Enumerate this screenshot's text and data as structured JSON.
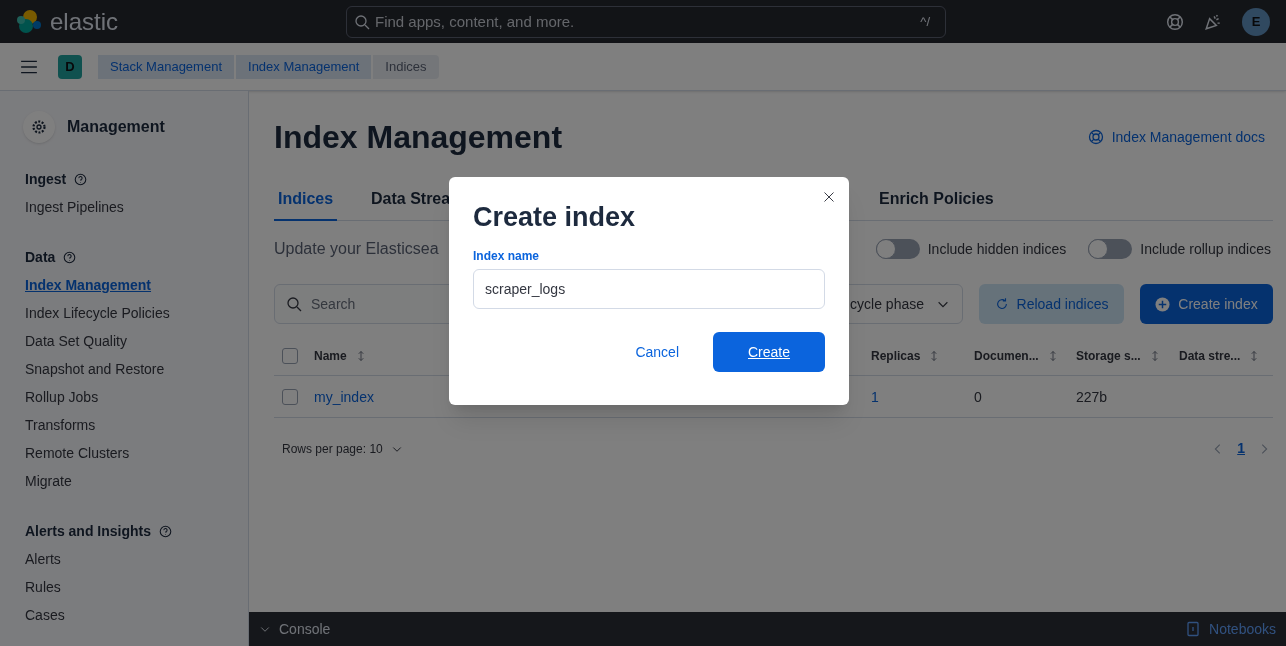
{
  "header": {
    "logo_text": "elastic",
    "search": {
      "placeholder": "Find apps, content, and more.",
      "shortcut": "^/"
    },
    "avatar": "E"
  },
  "breadcrumbs": {
    "space_badge": "D",
    "crumbs": [
      {
        "label": "Stack Management",
        "kind": "link"
      },
      {
        "label": "Index Management",
        "kind": "link"
      },
      {
        "label": "Indices",
        "kind": "current"
      }
    ]
  },
  "sidebar": {
    "title": "Management",
    "sections": [
      {
        "title": "Ingest",
        "items": [
          {
            "label": "Ingest Pipelines",
            "selected": false
          }
        ]
      },
      {
        "title": "Data",
        "items": [
          {
            "label": "Index Management",
            "selected": true
          },
          {
            "label": "Index Lifecycle Policies",
            "selected": false
          },
          {
            "label": "Data Set Quality",
            "selected": false
          },
          {
            "label": "Snapshot and Restore",
            "selected": false
          },
          {
            "label": "Rollup Jobs",
            "selected": false
          },
          {
            "label": "Transforms",
            "selected": false
          },
          {
            "label": "Remote Clusters",
            "selected": false
          },
          {
            "label": "Migrate",
            "selected": false
          }
        ]
      },
      {
        "title": "Alerts and Insights",
        "items": [
          {
            "label": "Alerts",
            "selected": false
          },
          {
            "label": "Rules",
            "selected": false
          },
          {
            "label": "Cases",
            "selected": false
          }
        ]
      }
    ]
  },
  "page": {
    "title": "Index Management",
    "docs_link": "Index Management docs",
    "tabs": [
      {
        "label": "Indices",
        "selected": true
      },
      {
        "label": "Data Strea",
        "selected": false
      },
      {
        "label": "Enrich Policies",
        "selected": false
      }
    ],
    "description": "Update your Elasticsea",
    "toggles": [
      {
        "label": "Include hidden indices",
        "on": false
      },
      {
        "label": "Include rollup indices",
        "on": false
      }
    ],
    "search": {
      "placeholder": "Search"
    },
    "filter": "cycle phase",
    "reload_button": "Reload indices",
    "create_button": "Create index",
    "table": {
      "select_all_checked": false,
      "columns": [
        "Name",
        "Replicas",
        "Documen...",
        "Storage s...",
        "Data stre..."
      ],
      "rows": [
        {
          "checked": false,
          "name": "my_index",
          "replicas": "1",
          "documents": "0",
          "storage": "227b"
        }
      ]
    },
    "pagination": {
      "rows_per_page": "Rows per page: 10",
      "pages": [
        {
          "label": "1",
          "selected": true
        }
      ]
    }
  },
  "console": {
    "label": "Console",
    "notebooks": "Notebooks"
  },
  "modal": {
    "title": "Create index",
    "field_label": "Index name",
    "field_value": "scraper_logs",
    "cancel": "Cancel",
    "create": "Create"
  }
}
